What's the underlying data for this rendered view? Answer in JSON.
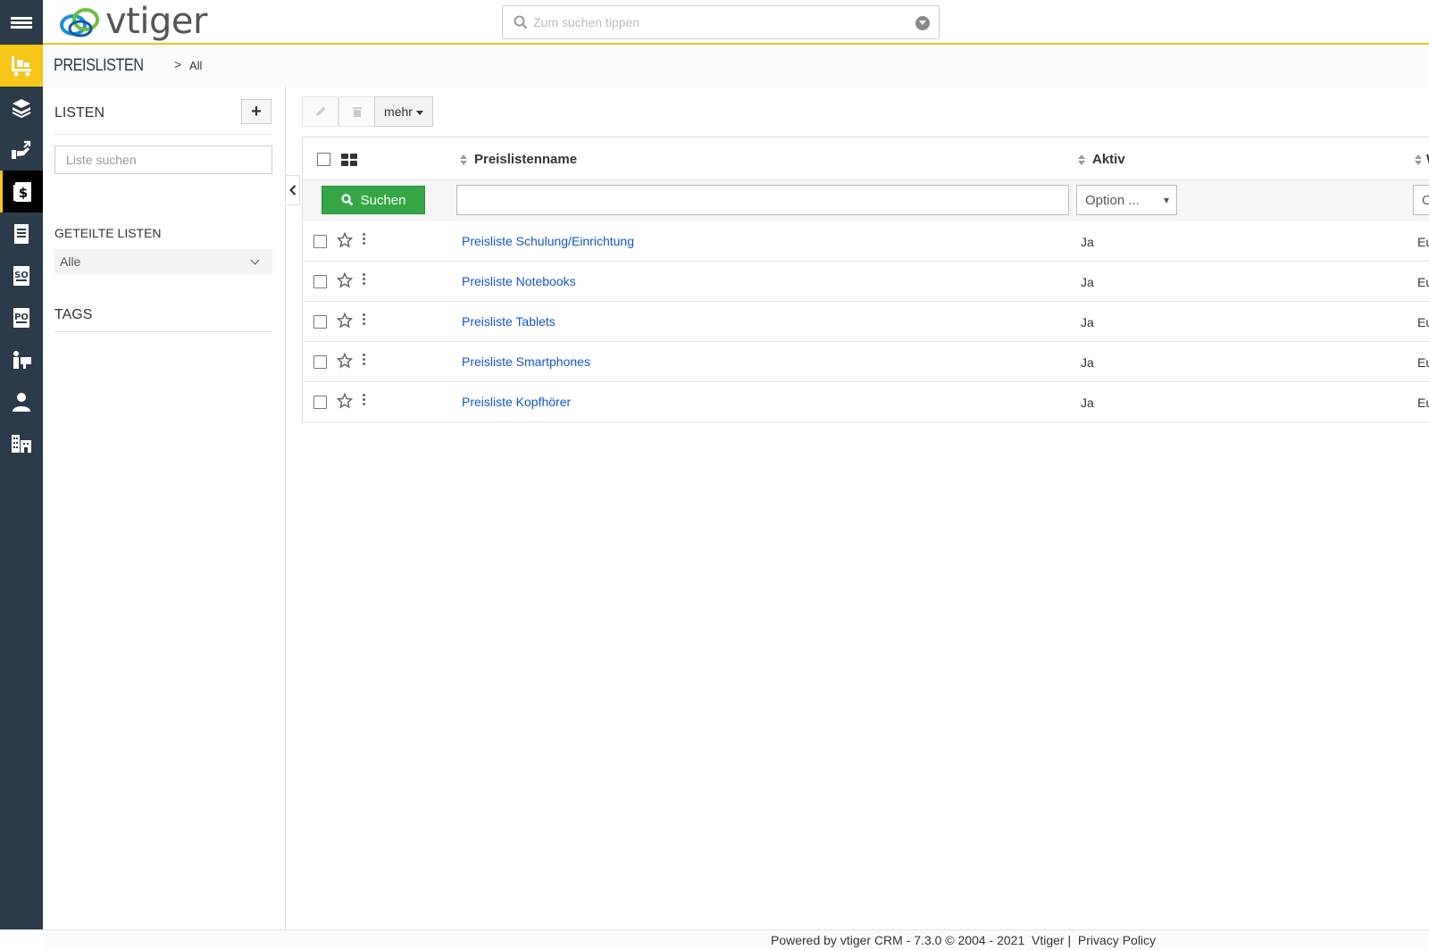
{
  "app": {
    "logo_text": "vtiger",
    "brand_colors": {
      "rail": "#2c3b49",
      "accent": "#f5c518",
      "link": "#1155cc",
      "search_button": "#35a745"
    }
  },
  "header": {
    "search_placeholder": "Zum suchen tippen",
    "search_icon": "search-icon",
    "dropdown_icon": "chevron-circle-down-icon"
  },
  "rail": {
    "items": [
      {
        "icon": "inventory-cart-icon",
        "active": true
      },
      {
        "icon": "products-box-icon"
      },
      {
        "icon": "services-hand-icon"
      },
      {
        "icon": "price-book-icon",
        "selected": true
      },
      {
        "icon": "invoice-icon"
      },
      {
        "icon": "sales-order-icon"
      },
      {
        "icon": "purchase-order-icon"
      },
      {
        "icon": "vendors-icon"
      },
      {
        "icon": "contacts-person-icon"
      },
      {
        "icon": "organizations-building-icon"
      }
    ]
  },
  "breadcrumb": {
    "module": "PREISLISTEN",
    "separator": ">",
    "view": "All"
  },
  "left_panel": {
    "lists_heading": "LISTEN",
    "add_button_label": "+",
    "list_search_placeholder": "Liste suchen",
    "shared_heading": "GETEILTE LISTEN",
    "shared_selected": "Alle",
    "tags_heading": "TAGS"
  },
  "toolbar": {
    "edit_icon": "pencil-icon",
    "delete_icon": "trash-icon",
    "more_label": "mehr"
  },
  "table": {
    "columns": [
      {
        "label": "Preislistenname"
      },
      {
        "label": "Aktiv"
      },
      {
        "label": "W"
      }
    ],
    "filters": {
      "search_button_label": "Suchen",
      "name_value": "",
      "active_placeholder": "Option ...",
      "third_placeholder": "O"
    },
    "rows": [
      {
        "name": "Preisliste Schulung/Einrichtung",
        "active": "Ja",
        "third": "Eu"
      },
      {
        "name": "Preisliste Notebooks",
        "active": "Ja",
        "third": "Eu"
      },
      {
        "name": "Preisliste Tablets",
        "active": "Ja",
        "third": "Eu"
      },
      {
        "name": "Preisliste Smartphones",
        "active": "Ja",
        "third": "Eu"
      },
      {
        "name": "Preisliste Kopfhörer",
        "active": "Ja",
        "third": "Eu"
      }
    ]
  },
  "footer": {
    "powered_by": "Powered by vtiger CRM - 7.3.0  © 2004 - 2021",
    "vtiger_link": "Vtiger",
    "separator": "|",
    "privacy_link": "Privacy Policy"
  }
}
